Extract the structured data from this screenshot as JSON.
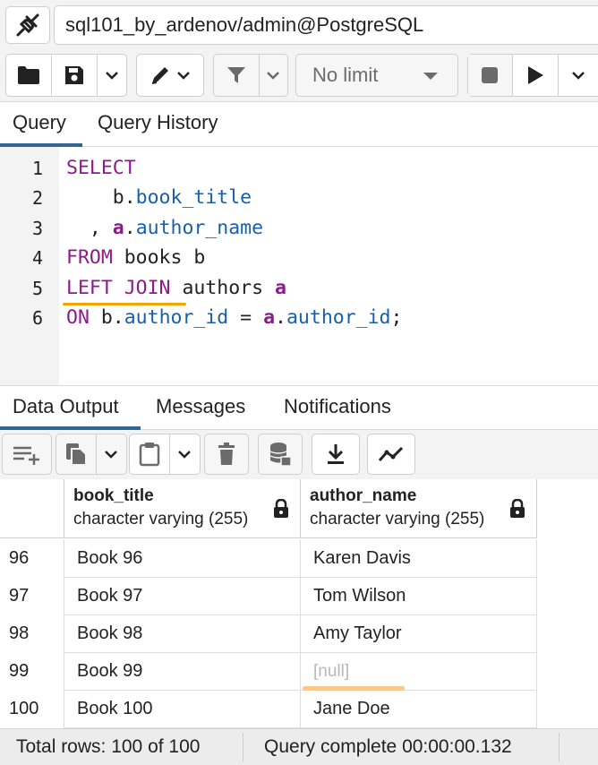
{
  "connection": {
    "label": "sql101_by_ardenov/admin@PostgreSQL"
  },
  "toolbar": {
    "limit_value": "No limit"
  },
  "query_tabs": [
    "Query",
    "Query History"
  ],
  "editor": {
    "line_numbers": [
      "1",
      "2",
      "3",
      "4",
      "5",
      "6"
    ]
  },
  "output_tabs": [
    "Data Output",
    "Messages",
    "Notifications"
  ],
  "grid": {
    "columns": [
      {
        "name": "book_title",
        "type": "character varying (255)"
      },
      {
        "name": "author_name",
        "type": "character varying (255)"
      }
    ],
    "rows": [
      {
        "num": "96",
        "book_title": "Book 96",
        "author_name": "Karen Davis"
      },
      {
        "num": "97",
        "book_title": "Book 97",
        "author_name": "Tom Wilson"
      },
      {
        "num": "98",
        "book_title": "Book 98",
        "author_name": "Amy Taylor"
      },
      {
        "num": "99",
        "book_title": "Book 99",
        "author_name": "[null]"
      },
      {
        "num": "100",
        "book_title": "Book 100",
        "author_name": "Jane Doe"
      }
    ]
  },
  "status": {
    "total_rows": "Total rows: 100 of 100",
    "query_complete": "Query complete 00:00:00.132"
  },
  "icons": {
    "connection": "disconnect-plug-icon",
    "open_file": "folder-icon",
    "save": "save-icon",
    "edit": "pencil-icon",
    "filter": "filter-icon",
    "stop": "stop-icon",
    "execute": "play-icon",
    "add_row": "add-row-icon",
    "copy": "copy-icon",
    "paste": "paste-icon",
    "delete": "trash-icon",
    "save_data": "save-data-icon",
    "download": "download-icon",
    "graph": "graph-icon",
    "lock": "lock-icon"
  },
  "colors": {
    "keyword": "#8b1a8b",
    "identifier": "#1a5fa8",
    "active_tab": "#326690",
    "highlight": "#f5a300"
  }
}
